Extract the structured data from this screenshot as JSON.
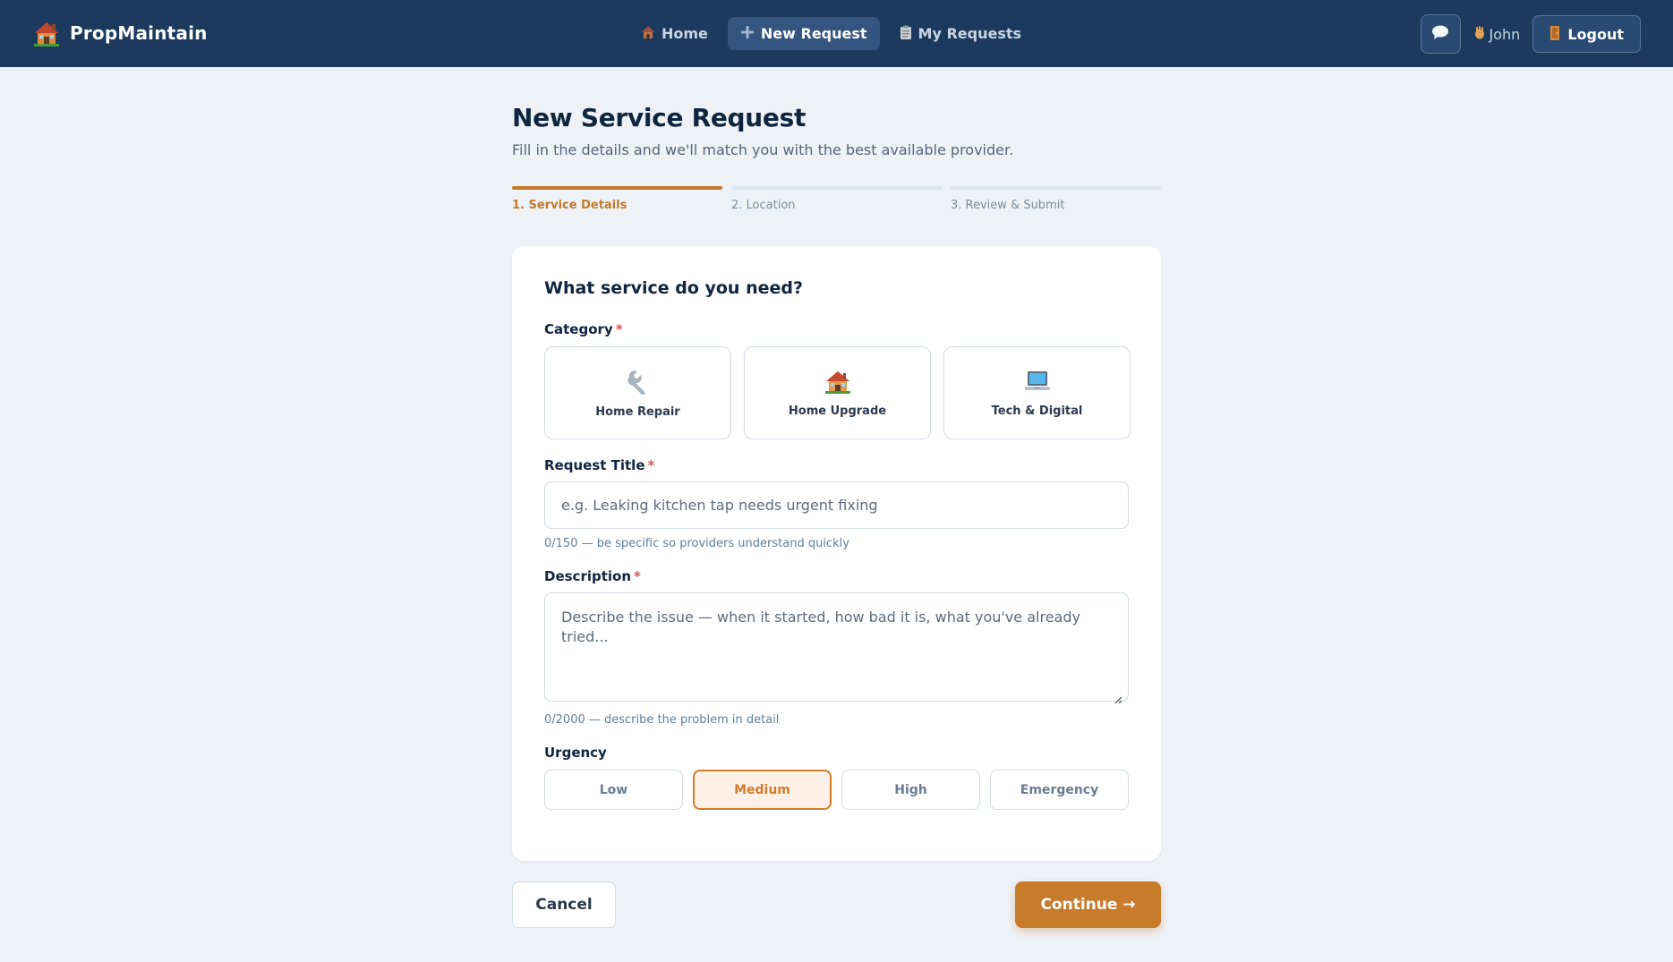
{
  "brand": {
    "name": "PropMaintain",
    "icon": "house-icon"
  },
  "nav": {
    "links": [
      {
        "label": "Home",
        "icon": "house-icon"
      },
      {
        "label": "New Request",
        "icon": "plus-icon"
      },
      {
        "label": "My Requests",
        "icon": "clipboard-icon"
      }
    ],
    "active_index": 1
  },
  "user": {
    "greeting": "John",
    "chat_icon": "chat-bubble-icon",
    "wave_icon": "wave-hand-icon"
  },
  "logout": {
    "label": "Logout",
    "icon": "door-icon"
  },
  "page": {
    "title": "New Service Request",
    "subtitle": "Fill in the details and we'll match you with the best available provider."
  },
  "stepper": {
    "steps": [
      "1. Service Details",
      "2. Location",
      "3. Review & Submit"
    ],
    "active_index": 0
  },
  "form": {
    "heading": "What service do you need?",
    "category": {
      "label": "Category",
      "required_mark": "*",
      "options": [
        {
          "label": "Home Repair",
          "icon": "wrench-icon"
        },
        {
          "label": "Home Upgrade",
          "icon": "house-icon"
        },
        {
          "label": "Tech & Digital",
          "icon": "laptop-icon"
        }
      ]
    },
    "title": {
      "label": "Request Title",
      "required_mark": "*",
      "value": "",
      "placeholder": "e.g. Leaking kitchen tap needs urgent fixing",
      "hint": "0/150 — be specific so providers understand quickly"
    },
    "description": {
      "label": "Description",
      "required_mark": "*",
      "value": "",
      "placeholder": "Describe the issue — when it started, how bad it is, what you've already tried...",
      "hint": "0/2000 — describe the problem in detail"
    },
    "urgency": {
      "label": "Urgency",
      "options": [
        "Low",
        "Medium",
        "High",
        "Emergency"
      ],
      "selected": "Medium"
    }
  },
  "actions": {
    "cancel": "Cancel",
    "continue": "Continue →"
  },
  "colors": {
    "navbar": "#1b3a5e",
    "accent": "#c97b2c",
    "page_bg": "#eef2f7",
    "required": "#d9534f"
  }
}
